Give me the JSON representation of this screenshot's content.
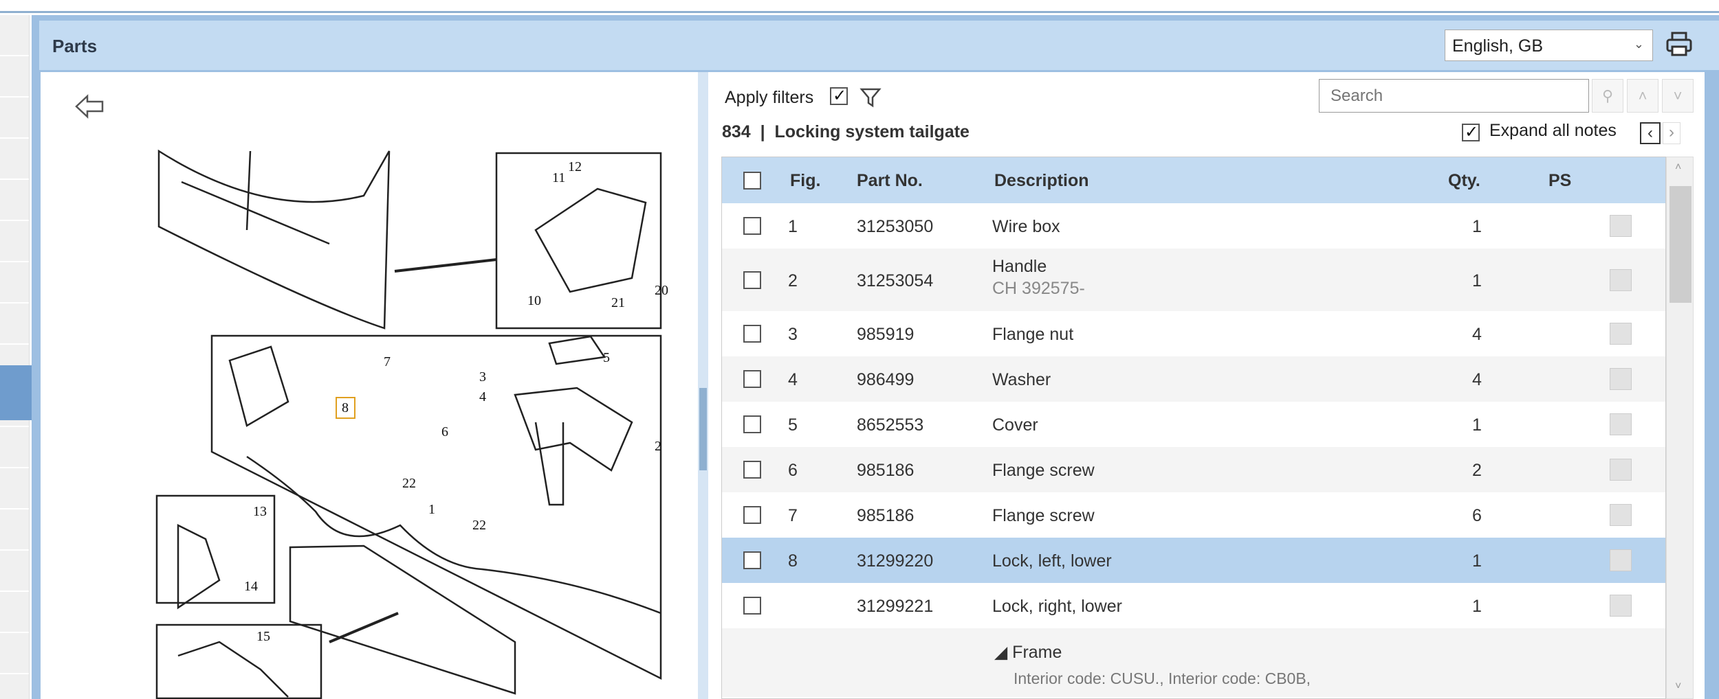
{
  "header": {
    "title": "Parts",
    "language": "English, GB"
  },
  "toolbar": {
    "apply_filters": "Apply filters",
    "apply_filters_checked": true,
    "search_placeholder": "Search",
    "expand_all_notes": "Expand all notes",
    "expand_all_checked": true
  },
  "group": {
    "number": "834",
    "separator": "|",
    "title": "Locking system tailgate"
  },
  "table": {
    "headers": {
      "fig": "Fig.",
      "part_no": "Part No.",
      "description": "Description",
      "qty": "Qty.",
      "ps": "PS"
    },
    "rows": [
      {
        "fig": "1",
        "part_no": "31253050",
        "description": "Wire box",
        "sub": "",
        "qty": "1"
      },
      {
        "fig": "2",
        "part_no": "31253054",
        "description": "Handle",
        "sub": "CH 392575-",
        "qty": "1"
      },
      {
        "fig": "3",
        "part_no": "985919",
        "description": "Flange nut",
        "sub": "",
        "qty": "4"
      },
      {
        "fig": "4",
        "part_no": "986499",
        "description": "Washer",
        "sub": "",
        "qty": "4"
      },
      {
        "fig": "5",
        "part_no": "8652553",
        "description": "Cover",
        "sub": "",
        "qty": "1"
      },
      {
        "fig": "6",
        "part_no": "985186",
        "description": "Flange screw",
        "sub": "",
        "qty": "2"
      },
      {
        "fig": "7",
        "part_no": "985186",
        "description": "Flange screw",
        "sub": "",
        "qty": "6"
      },
      {
        "fig": "8",
        "part_no": "31299220",
        "description": "Lock, left, lower",
        "sub": "",
        "qty": "1"
      },
      {
        "fig": "",
        "part_no": "31299221",
        "description": "Lock, right, lower",
        "sub": "",
        "qty": "1"
      }
    ],
    "note": {
      "title": "Frame",
      "text": "Interior code: CUSU., Interior code: CB0B,"
    }
  },
  "diagram": {
    "labels": [
      "12",
      "11",
      "10",
      "21",
      "20",
      "7",
      "8",
      "5",
      "3",
      "4",
      "6",
      "2",
      "22",
      "1",
      "22",
      "13",
      "14",
      "15"
    ]
  }
}
